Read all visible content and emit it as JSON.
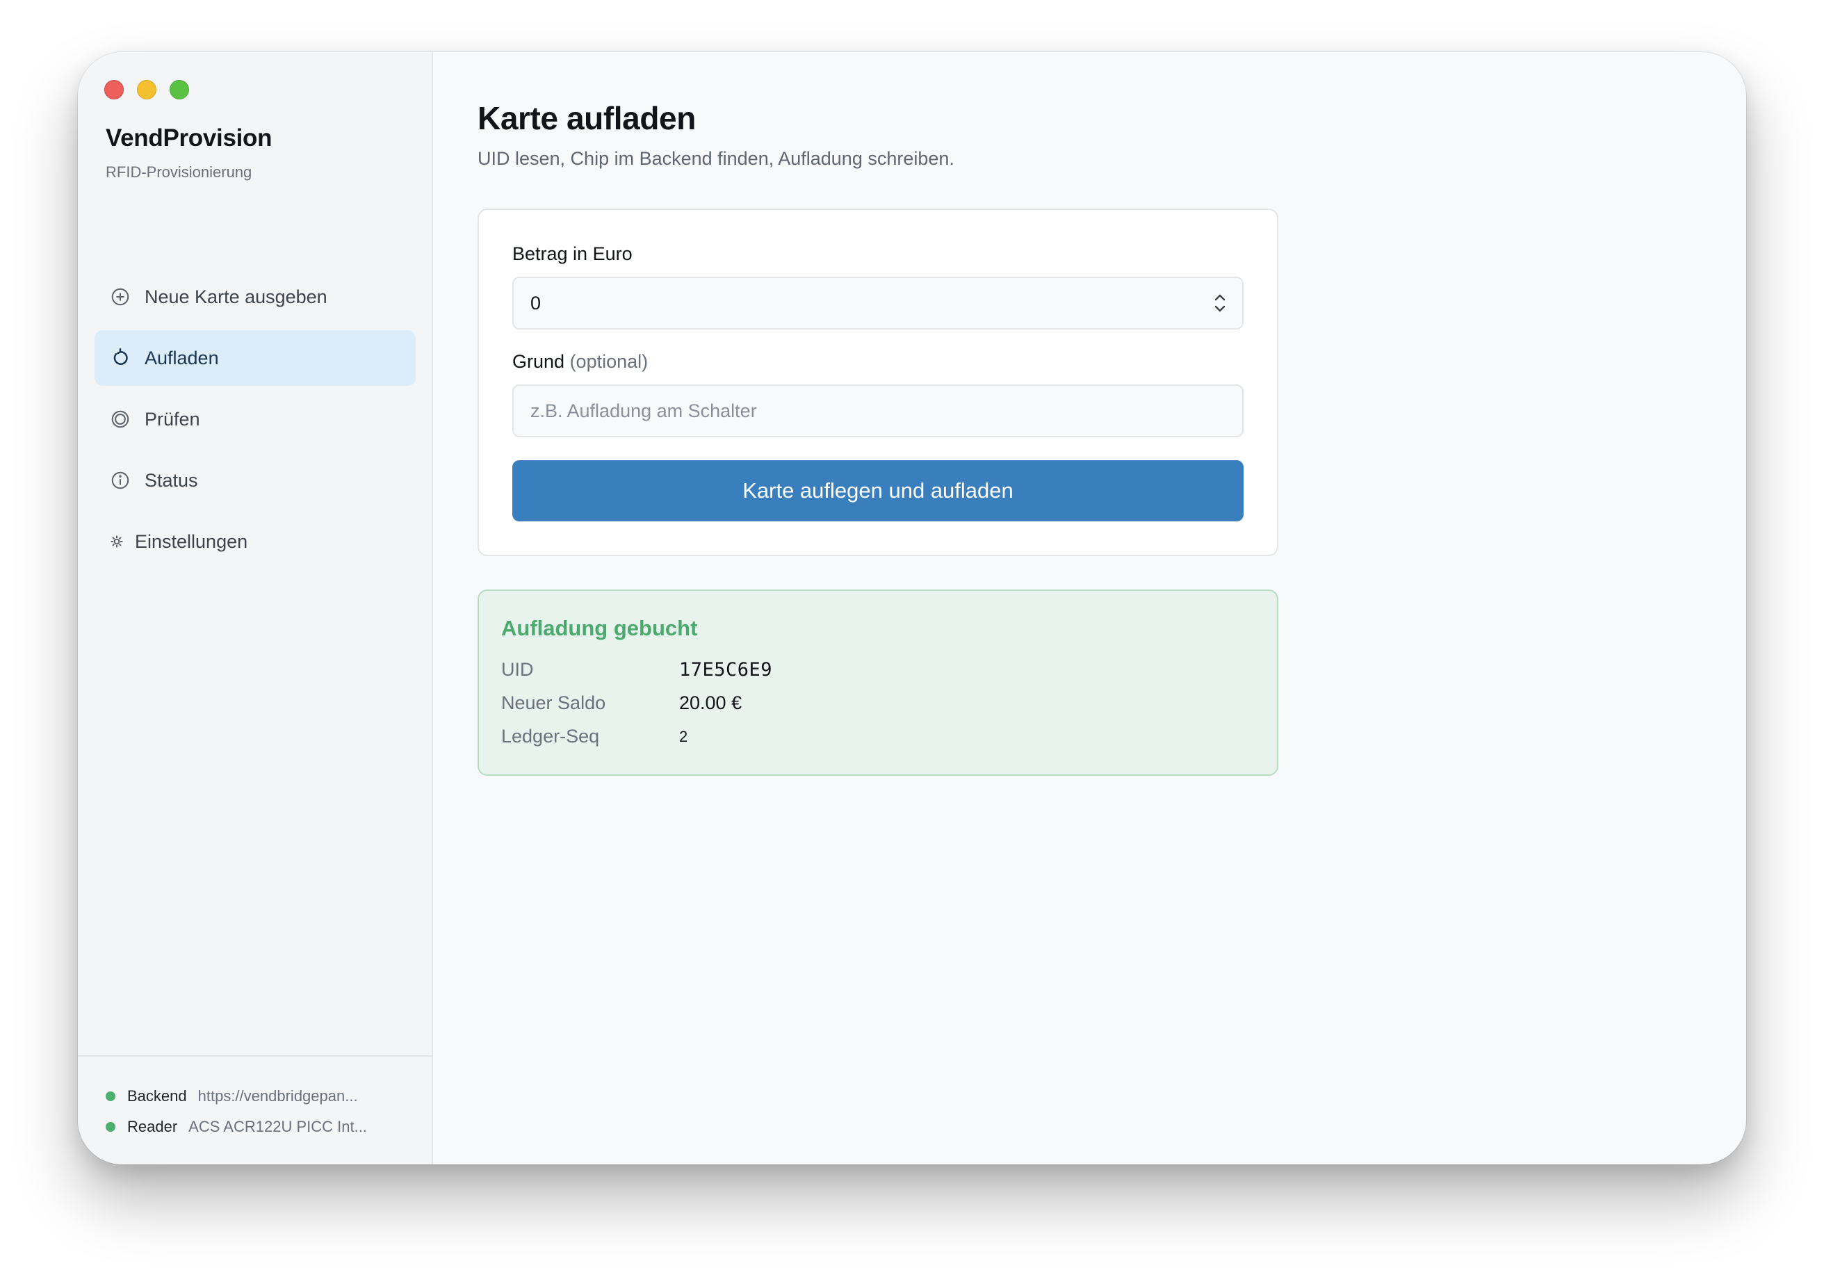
{
  "sidebar": {
    "app_title": "VendProvision",
    "app_subtitle": "RFID-Provisionierung",
    "items": [
      {
        "label": "Neue Karte ausgeben",
        "icon": "plus-circle-icon"
      },
      {
        "label": "Aufladen",
        "icon": "refresh-icon",
        "active": true
      },
      {
        "label": "Prüfen",
        "icon": "target-circle-icon"
      },
      {
        "label": "Status",
        "icon": "info-icon"
      },
      {
        "label": "Einstellungen",
        "icon": "gear-icon"
      }
    ],
    "footer": {
      "backend_label": "Backend",
      "backend_value": "https://vendbridgepan...",
      "reader_label": "Reader",
      "reader_value": "ACS ACR122U PICC Int..."
    }
  },
  "main": {
    "title": "Karte aufladen",
    "subtitle": "UID lesen, Chip im Backend finden, Aufladung schreiben.",
    "form": {
      "amount_label": "Betrag in Euro",
      "amount_value": "0",
      "reason_label": "Grund",
      "reason_optional": "(optional)",
      "reason_placeholder": "z.B. Aufladung am Schalter",
      "submit_label": "Karte auflegen und aufladen"
    },
    "result": {
      "title": "Aufladung gebucht",
      "uid_label": "UID",
      "uid_value": "17E5C6E9",
      "balance_label": "Neuer Saldo",
      "balance_value": "20.00 €",
      "seq_label": "Ledger-Seq",
      "seq_value": "2"
    }
  },
  "colors": {
    "accent": "#3a7fbd",
    "active_nav": "#dcedf9",
    "success": "#4aa96c",
    "success_bg": "#e9f3ee"
  }
}
